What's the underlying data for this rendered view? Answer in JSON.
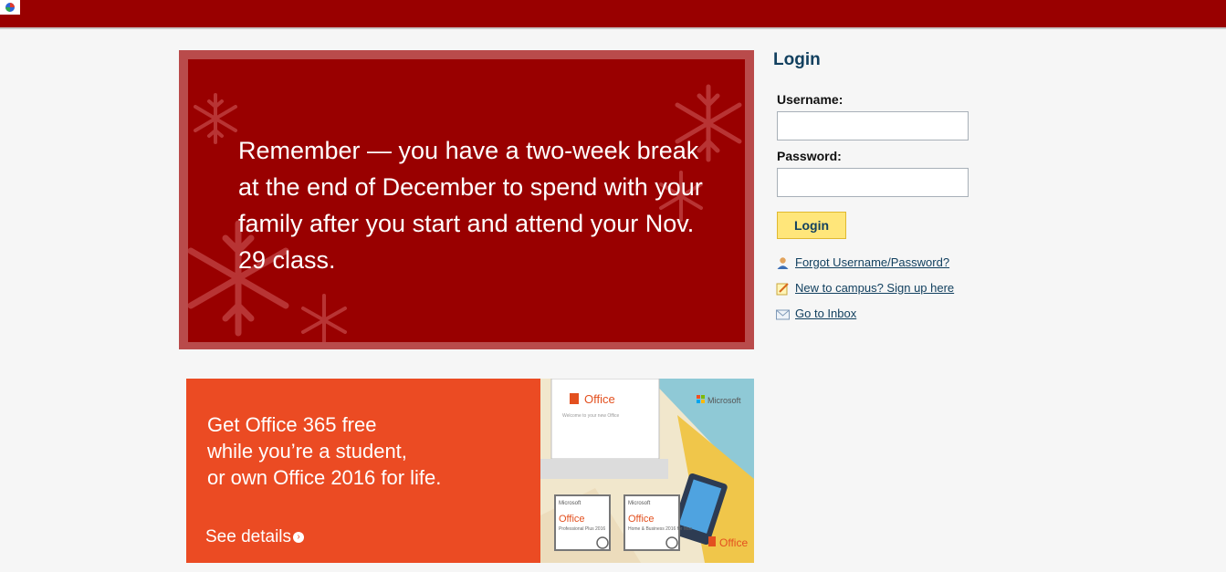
{
  "banner": {
    "text": "Remember — you have a two-week break at the end of December to spend with your family after you start and attend your Nov. 29 class."
  },
  "office_ad": {
    "line1": "Get Office 365 free",
    "line2": "while you’re a student,",
    "line3": "or own Office 2016 for life.",
    "cta": "See details",
    "art": {
      "office_title": "Office",
      "welcome": "Welcome to your new Office",
      "brand": "Microsoft",
      "box1_brand": "Microsoft",
      "box1_product": "Office",
      "box1_edition": "Professional Plus 2016",
      "box2_brand": "Microsoft",
      "box2_product": "Office",
      "box2_edition": "Home & Business 2016 for Mac",
      "footer_logo": "Office"
    }
  },
  "login": {
    "title": "Login",
    "username_label": "Username:",
    "username_value": "",
    "password_label": "Password:",
    "password_value": "",
    "submit_label": "Login",
    "links": {
      "forgot": "Forgot Username/Password?",
      "signup": "New to campus? Sign up here",
      "inbox": "Go to Inbox"
    }
  },
  "colors": {
    "topbar": "#990000",
    "banner_bg": "#990000",
    "banner_border": "#b94b4b",
    "office_orange": "#eb4b23",
    "login_title": "#12405f",
    "button_bg": "#ffe67a"
  }
}
